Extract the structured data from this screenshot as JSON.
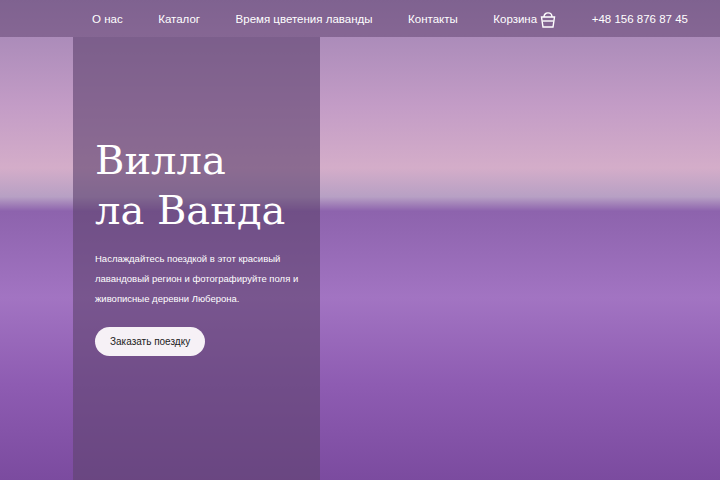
{
  "nav": {
    "items": [
      {
        "label": "О нас",
        "kind": "link"
      },
      {
        "label": "Каталог",
        "kind": "link"
      },
      {
        "label": "Время цветения лаванды",
        "kind": "link"
      },
      {
        "label": "Контакты",
        "kind": "link"
      },
      {
        "label": "Корзина",
        "kind": "cart"
      }
    ],
    "phone": "+48 156 876 87 45"
  },
  "hero": {
    "title_lines": [
      "Вилла",
      "ла Ванда"
    ],
    "description": "Наслаждайтесь поездкой в этот красивый лавандовый регион и фотографируйте поля и живописные деревни Люберона.",
    "button": "Заказать поездку"
  }
}
